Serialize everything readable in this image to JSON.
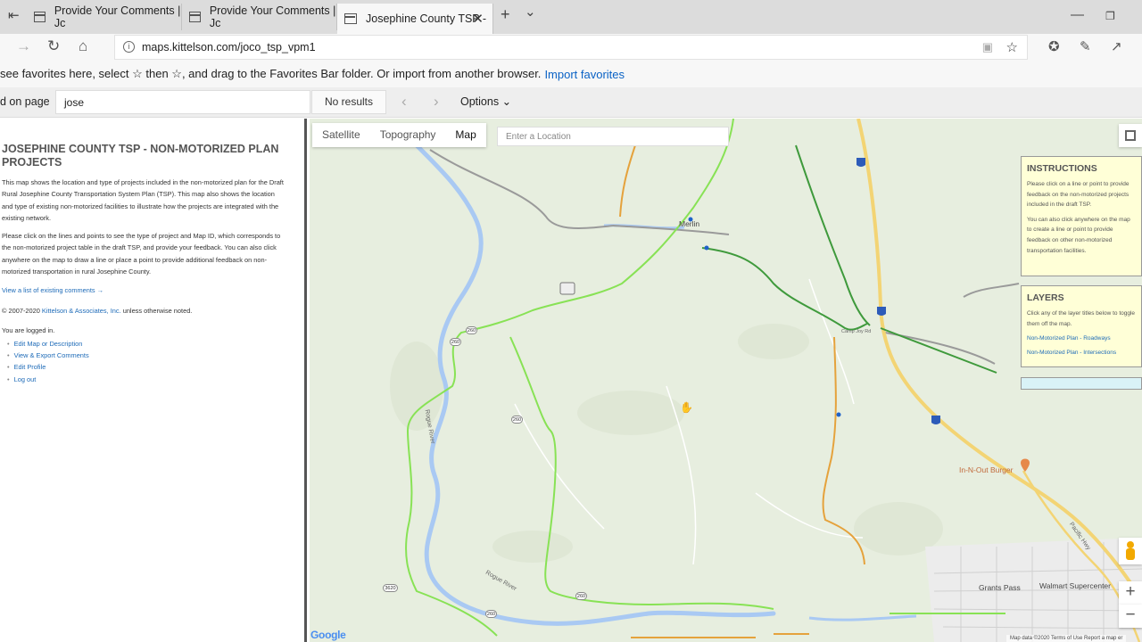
{
  "browser": {
    "tabs": [
      {
        "title": "Provide Your Comments | Jc"
      },
      {
        "title": "Provide Your Comments | Jc"
      },
      {
        "title": "Josephine County TSP -"
      }
    ],
    "new_tab_glyph": "+",
    "tab_list_glyph": "⌄",
    "url": "maps.kittelson.com/joco_tsp_vpm1",
    "favorites_message": "see favorites here, select ☆ then ☆, and drag to the Favorites Bar folder. Or import from another browser.",
    "import_favorites": "Import favorites",
    "find": {
      "label": "d on page",
      "query": "jose",
      "results": "No results",
      "options": "Options"
    }
  },
  "sidebar": {
    "title": "JOSEPHINE COUNTY TSP - NON-MOTORIZED PLAN PROJECTS",
    "para1": "This map shows the location and type of projects included in the non-motorized plan for the Draft Rural Josephine County Transportation System Plan (TSP). This map also shows the location and type of existing non-motorized facilities to illustrate how the projects are integrated with the existing network.",
    "para2": "Please click on the lines and points to see the type of project and Map ID, which corresponds to the non-motorized project table in the draft TSP, and provide your feedback. You can also click anywhere on the map to draw a line or place a point to provide additional feedback on non-motorized transportation in rural Josephine County.",
    "view_comments": "View a list of existing comments →",
    "copyright_prefix": "© 2007-2020",
    "copyright_link": "Kittelson & Associates, Inc.",
    "copyright_suffix": "unless otherwise noted.",
    "logged_in": "You are logged in.",
    "links": [
      "Edit Map or Description",
      "View & Export Comments",
      "Edit Profile",
      "Log out"
    ]
  },
  "map": {
    "types": [
      "Satellite",
      "Topography",
      "Map"
    ],
    "selected_type": "Map",
    "search_placeholder": "Enter a Location",
    "instructions": {
      "title": "INSTRUCTIONS",
      "p1": "Please click on a line or point to provide feedback on the non-motorized projects included in the draft TSP.",
      "p2": "You can also click anywhere on the map to create a line or point to provide feedback on other non-motorized transportation facilities."
    },
    "layers": {
      "title": "LAYERS",
      "desc": "Click any of the layer titles below to toggle them off the map.",
      "items": [
        "Non-Motorized Plan - Roadways",
        "Non-Motorized Plan - Intersections"
      ]
    },
    "places": [
      "Merlin",
      "Camp Joy Rd",
      "In-N-Out Burger",
      "Grants Pass",
      "Walmart Supercenter",
      "Rogue River",
      "Rogue River",
      "Pacific Hwy"
    ],
    "shields": [
      "5",
      "5",
      "5",
      "260",
      "260",
      "260",
      "260",
      "260",
      "3620"
    ],
    "zoom_in": "+",
    "zoom_out": "−",
    "google": "Google",
    "attribution": "Map data ©2020   Terms of Use   Report a map er",
    "colors": {
      "existing": "#88e255",
      "planned": "#e5a23c",
      "highway": "#f3d474",
      "river": "#a9c9f3",
      "land": "#e7eedf"
    }
  }
}
